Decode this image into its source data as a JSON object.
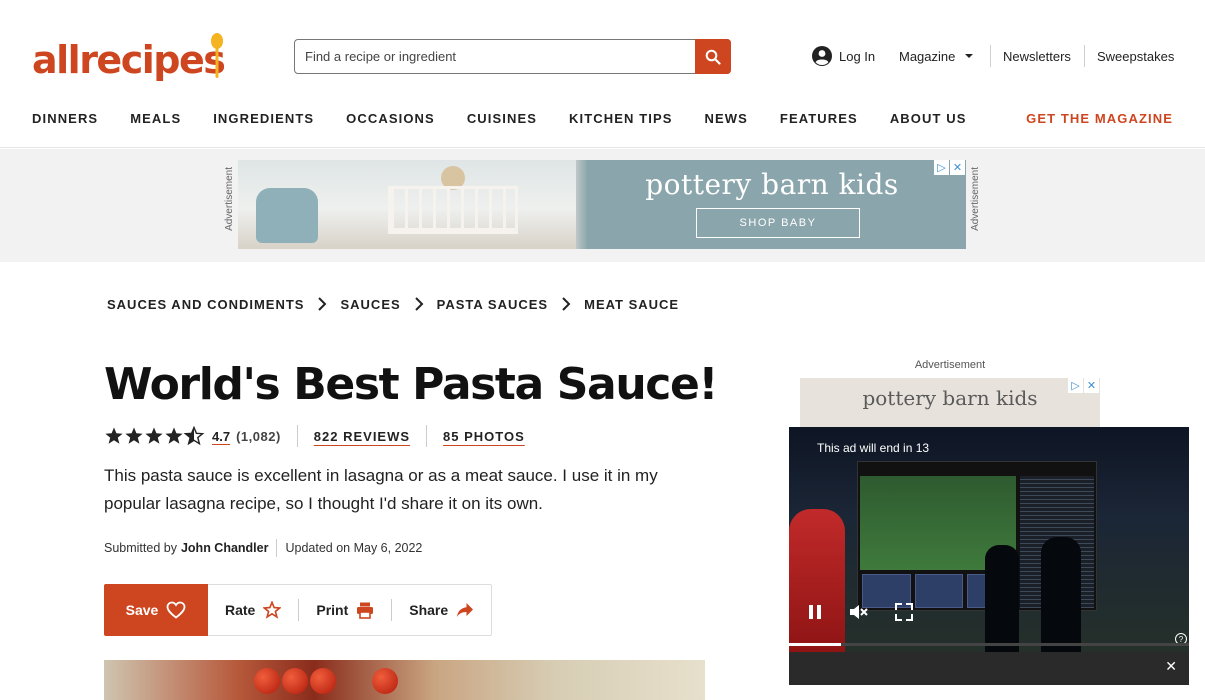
{
  "brand": {
    "name": "allrecipes",
    "accent": "#ce4620"
  },
  "search": {
    "placeholder": "Find a recipe or ingredient",
    "icon": "search-icon"
  },
  "utility": {
    "login": "Log In",
    "magazine": "Magazine",
    "newsletters": "Newsletters",
    "sweepstakes": "Sweepstakes"
  },
  "nav": {
    "items": [
      "DINNERS",
      "MEALS",
      "INGREDIENTS",
      "OCCASIONS",
      "CUISINES",
      "KITCHEN TIPS",
      "NEWS",
      "FEATURES",
      "ABOUT US"
    ],
    "cta": "GET THE MAGAZINE"
  },
  "top_ad": {
    "label": "Advertisement",
    "brand": "pottery barn kids",
    "cta": "SHOP BABY"
  },
  "breadcrumb": [
    "SAUCES AND CONDIMENTS",
    "SAUCES",
    "PASTA SAUCES",
    "MEAT SAUCE"
  ],
  "recipe": {
    "title": "World's Best Pasta Sauce!",
    "rating": "4.7",
    "rating_value": 4.7,
    "rating_count": "(1,082)",
    "reviews": "822 REVIEWS",
    "photos": "85 PHOTOS",
    "description": "This pasta sauce is excellent in lasagna or as a meat sauce. I use it in my popular lasagna recipe, so I thought I'd share it on its own.",
    "submitted_label": "Submitted by",
    "author": "John Chandler",
    "updated": "Updated on May 6, 2022"
  },
  "actions": {
    "save": "Save",
    "rate": "Rate",
    "print": "Print",
    "share": "Share"
  },
  "rail_ad": {
    "label": "Advertisement",
    "brand": "pottery barn kids"
  },
  "video": {
    "notice": "This ad will end in 13",
    "progress": 0.13
  }
}
